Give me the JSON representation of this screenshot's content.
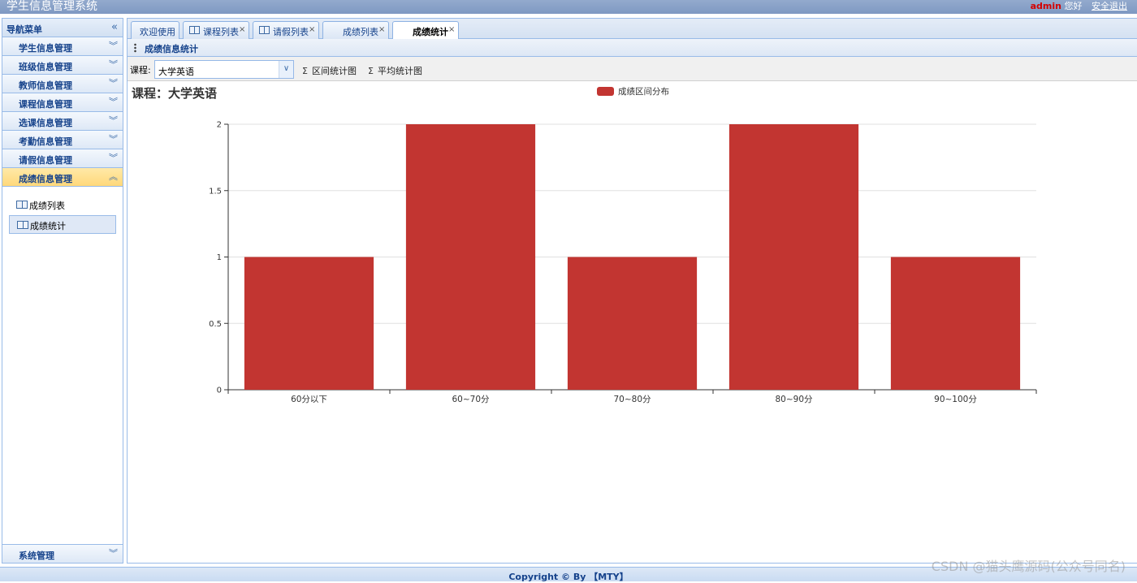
{
  "app": {
    "title": "学生信息管理系统",
    "user": "admin",
    "greeting": "您好",
    "logout": "安全退出"
  },
  "sidebar": {
    "title": "导航菜单",
    "items": [
      {
        "label": "学生信息管理"
      },
      {
        "label": "班级信息管理"
      },
      {
        "label": "教师信息管理"
      },
      {
        "label": "课程信息管理"
      },
      {
        "label": "选课信息管理"
      },
      {
        "label": "考勤信息管理"
      },
      {
        "label": "请假信息管理"
      },
      {
        "label": "成绩信息管理"
      }
    ],
    "active_section": "成绩信息管理",
    "subitems": [
      {
        "label": "成绩列表"
      },
      {
        "label": "成绩统计"
      }
    ],
    "selected_subitem": "成绩统计",
    "system": "系统管理"
  },
  "tabs": [
    {
      "label": "欢迎使用"
    },
    {
      "label": "课程列表"
    },
    {
      "label": "请假列表"
    },
    {
      "label": "成绩列表"
    },
    {
      "label": "成绩统计"
    }
  ],
  "active_tab": "成绩统计",
  "panel": {
    "title": "成绩信息统计"
  },
  "toolbar": {
    "course_label": "课程:",
    "course_value": "大学英语",
    "range_chart_btn": "区间统计图",
    "avg_chart_btn": "平均统计图"
  },
  "chart_data": {
    "type": "bar",
    "title": "课程：大学英语",
    "categories": [
      "60分以下",
      "60~70分",
      "70~80分",
      "80~90分",
      "90~100分"
    ],
    "series": [
      {
        "name": "成绩区间分布",
        "values": [
          1,
          2,
          1,
          2,
          1
        ]
      }
    ],
    "yticks": [
      "0",
      "0.5",
      "1",
      "1.5",
      "2"
    ],
    "ylim": [
      0,
      2
    ],
    "grid": true,
    "legend": "top-center",
    "color": "#c23531"
  },
  "footer": {
    "copyright": "Copyright © By 【MTY】"
  },
  "watermark": "CSDN @猫头鹰源码(公众号同名)"
}
